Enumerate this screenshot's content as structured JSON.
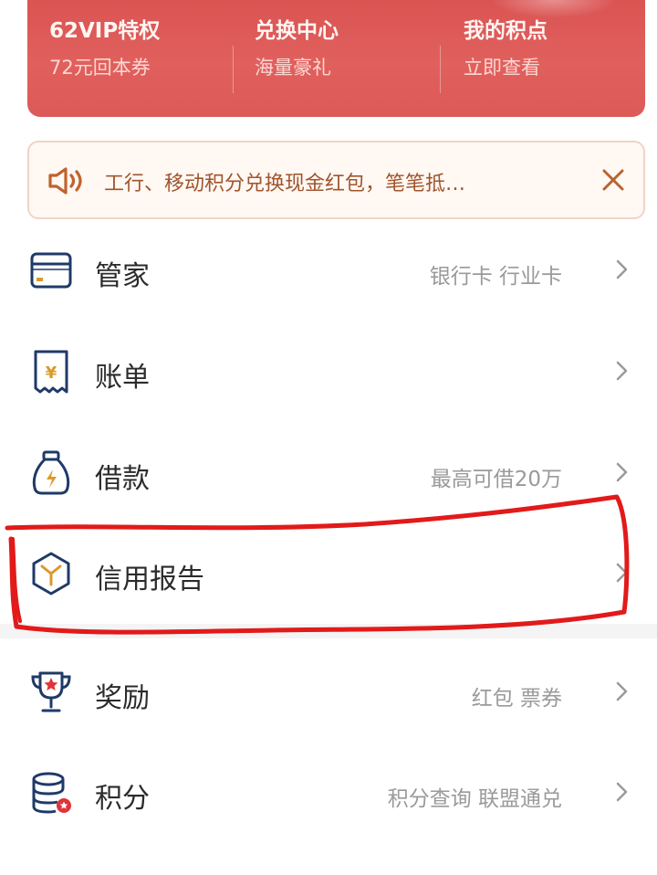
{
  "banner": {
    "items": [
      {
        "title": "62VIP特权",
        "subtitle": "72元回本券"
      },
      {
        "title": "兑换中心",
        "subtitle": "海量豪礼"
      },
      {
        "title": "我的积点",
        "subtitle": "立即查看"
      }
    ]
  },
  "notice": {
    "text": "工行、移动积分兑换现金红包，笔笔抵…",
    "icon": "speaker-icon",
    "close_icon": "close-icon"
  },
  "menu": {
    "items": [
      {
        "label": "管家",
        "hint": "银行卡 行业卡",
        "icon": "card-icon"
      },
      {
        "label": "账单",
        "hint": "",
        "icon": "bill-icon"
      },
      {
        "label": "借款",
        "hint": "最高可借20万",
        "icon": "money-bag-icon"
      },
      {
        "label": "信用报告",
        "hint": "",
        "icon": "credit-report-icon"
      },
      {
        "label": "奖励",
        "hint": "红包 票券",
        "icon": "trophy-icon"
      },
      {
        "label": "积分",
        "hint": "积分查询 联盟通兑",
        "icon": "points-icon"
      }
    ]
  },
  "colors": {
    "banner": "#dc5a58",
    "notice_text": "#a0552c",
    "icon_navy": "#1f3a68",
    "icon_gold": "#d99b2b",
    "annotation_red": "#e21a1a"
  }
}
